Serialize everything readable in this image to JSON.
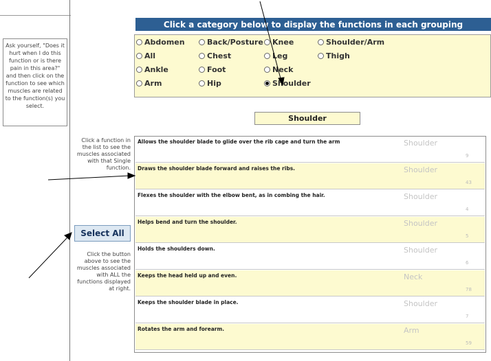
{
  "instructions": {
    "ask_text": "Ask yourself, \"Does it hurt when I do this function or is there pain in this area?\" and then click on the function to see which muscles are related to the function(s) you select."
  },
  "side_help": {
    "click_single": "Click a function in the list to see the muscles associated with that Single function.",
    "select_all_label": "Select All",
    "click_all": "Click the button above to see the muscles associated with ALL the functions displayed at right."
  },
  "category_header": "Click a category below to display the functions in each grouping",
  "categories": [
    {
      "label": "Abdomen",
      "selected": false
    },
    {
      "label": "Back/Posture",
      "selected": false
    },
    {
      "label": "Knee",
      "selected": false
    },
    {
      "label": "Shoulder/Arm",
      "selected": false
    },
    {
      "label": "All",
      "selected": false
    },
    {
      "label": "Chest",
      "selected": false
    },
    {
      "label": "Leg",
      "selected": false
    },
    {
      "label": "Thigh",
      "selected": false
    },
    {
      "label": "Ankle",
      "selected": false
    },
    {
      "label": "Foot",
      "selected": false
    },
    {
      "label": "Neck",
      "selected": false
    },
    {
      "label": "Arm",
      "selected": false
    },
    {
      "label": "Hip",
      "selected": false
    },
    {
      "label": "Shoulder",
      "selected": true
    }
  ],
  "selected_category": "Shoulder",
  "functions": [
    {
      "desc": "Allows the shoulder blade to glide over the rib cage and turn the arm",
      "category": "Shoulder",
      "id": "9"
    },
    {
      "desc": "Draws the shoulder blade forward and raises the ribs.",
      "category": "Shoulder",
      "id": "43"
    },
    {
      "desc": "Flexes the shoulder with the elbow bent, as in combing the hair.",
      "category": "Shoulder",
      "id": "4"
    },
    {
      "desc": "Helps bend and turn the shoulder.",
      "category": "Shoulder",
      "id": "5"
    },
    {
      "desc": "Holds the shoulders down.",
      "category": "Shoulder",
      "id": "6"
    },
    {
      "desc": "Keeps the head held up and even.",
      "category": "Neck",
      "id": "78"
    },
    {
      "desc": "Keeps the shoulder blade in place.",
      "category": "Shoulder",
      "id": "7"
    },
    {
      "desc": "Rotates the arm and forearm.",
      "category": "Arm",
      "id": "59"
    }
  ],
  "colors": {
    "header_blue": "#2d5f93",
    "panel_yellow": "#fdfad0",
    "button_blue": "#dde8f2"
  }
}
